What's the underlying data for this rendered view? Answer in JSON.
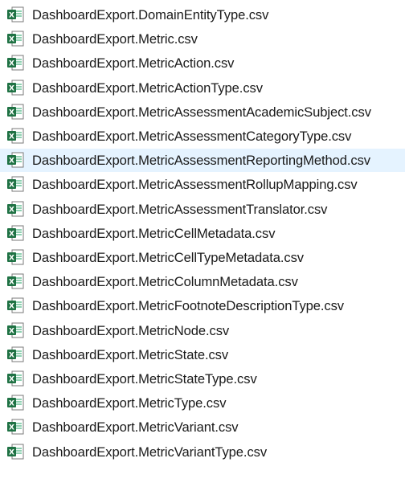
{
  "files": [
    {
      "name": "DashboardExport.DomainEntityType.csv",
      "icon": "excel-csv-icon"
    },
    {
      "name": "DashboardExport.Metric.csv",
      "icon": "excel-csv-icon"
    },
    {
      "name": "DashboardExport.MetricAction.csv",
      "icon": "excel-csv-icon"
    },
    {
      "name": "DashboardExport.MetricActionType.csv",
      "icon": "excel-csv-icon"
    },
    {
      "name": "DashboardExport.MetricAssessmentAcademicSubject.csv",
      "icon": "excel-csv-icon"
    },
    {
      "name": "DashboardExport.MetricAssessmentCategoryType.csv",
      "icon": "excel-csv-icon"
    },
    {
      "name": "DashboardExport.MetricAssessmentReportingMethod.csv",
      "icon": "excel-csv-icon"
    },
    {
      "name": "DashboardExport.MetricAssessmentRollupMapping.csv",
      "icon": "excel-csv-icon"
    },
    {
      "name": "DashboardExport.MetricAssessmentTranslator.csv",
      "icon": "excel-csv-icon"
    },
    {
      "name": "DashboardExport.MetricCellMetadata.csv",
      "icon": "excel-csv-icon"
    },
    {
      "name": "DashboardExport.MetricCellTypeMetadata.csv",
      "icon": "excel-csv-icon"
    },
    {
      "name": "DashboardExport.MetricColumnMetadata.csv",
      "icon": "excel-csv-icon"
    },
    {
      "name": "DashboardExport.MetricFootnoteDescriptionType.csv",
      "icon": "excel-csv-icon"
    },
    {
      "name": "DashboardExport.MetricNode.csv",
      "icon": "excel-csv-icon"
    },
    {
      "name": "DashboardExport.MetricState.csv",
      "icon": "excel-csv-icon"
    },
    {
      "name": "DashboardExport.MetricStateType.csv",
      "icon": "excel-csv-icon"
    },
    {
      "name": "DashboardExport.MetricType.csv",
      "icon": "excel-csv-icon"
    },
    {
      "name": "DashboardExport.MetricVariant.csv",
      "icon": "excel-csv-icon"
    },
    {
      "name": "DashboardExport.MetricVariantType.csv",
      "icon": "excel-csv-icon"
    }
  ],
  "hovered_index": 6,
  "colors": {
    "hover_background": "#e5f3ff",
    "excel_green": "#1f7244",
    "excel_green_light": "#21a366",
    "sheet_background": "#ffffff"
  }
}
